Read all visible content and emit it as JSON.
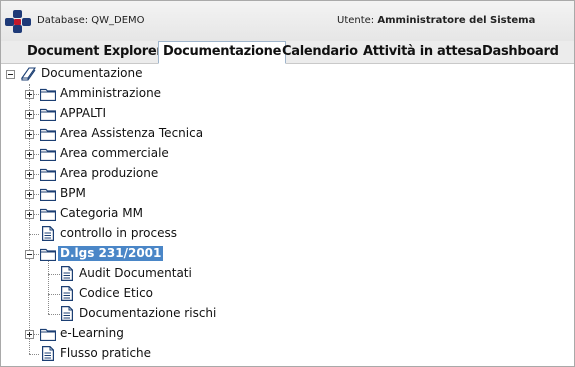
{
  "header": {
    "database_label": "Database: QW_DEMO",
    "user_prefix": "Utente: ",
    "user_name": "Amministratore del Sistema"
  },
  "tabs": [
    {
      "label": "Document Explorer",
      "active": false
    },
    {
      "label": "Documentazione",
      "active": true
    },
    {
      "label": "Calendario",
      "active": false
    },
    {
      "label": "Attività in attesa",
      "active": false
    },
    {
      "label": "Dashboard",
      "active": false
    }
  ],
  "tree": {
    "root": {
      "label": "Documentazione",
      "icon": "book-icon",
      "expanded": true
    },
    "items": [
      {
        "label": "Amministrazione",
        "type": "folder",
        "expanded": false
      },
      {
        "label": "APPALTI",
        "type": "folder",
        "expanded": false
      },
      {
        "label": "Area Assistenza Tecnica",
        "type": "folder",
        "expanded": false
      },
      {
        "label": "Area commerciale",
        "type": "folder",
        "expanded": false
      },
      {
        "label": "Area produzione",
        "type": "folder",
        "expanded": false
      },
      {
        "label": "BPM",
        "type": "folder",
        "expanded": false
      },
      {
        "label": "Categoria MM",
        "type": "folder",
        "expanded": false
      },
      {
        "label": "controllo in process",
        "type": "document"
      },
      {
        "label": "D.lgs 231/2001",
        "type": "folder",
        "expanded": true,
        "selected": true,
        "children": [
          {
            "label": "Audit Documentati",
            "type": "document"
          },
          {
            "label": "Codice Etico",
            "type": "document"
          },
          {
            "label": "Documentazione rischi",
            "type": "document"
          }
        ]
      },
      {
        "label": "e-Learning",
        "type": "folder",
        "expanded": false
      },
      {
        "label": "Flusso pratiche",
        "type": "document"
      }
    ]
  },
  "colors": {
    "selection": "#4a86c7",
    "folder_stroke": "#1c3f73",
    "logo_red": "#c0182b",
    "logo_blue": "#1e3a78"
  }
}
